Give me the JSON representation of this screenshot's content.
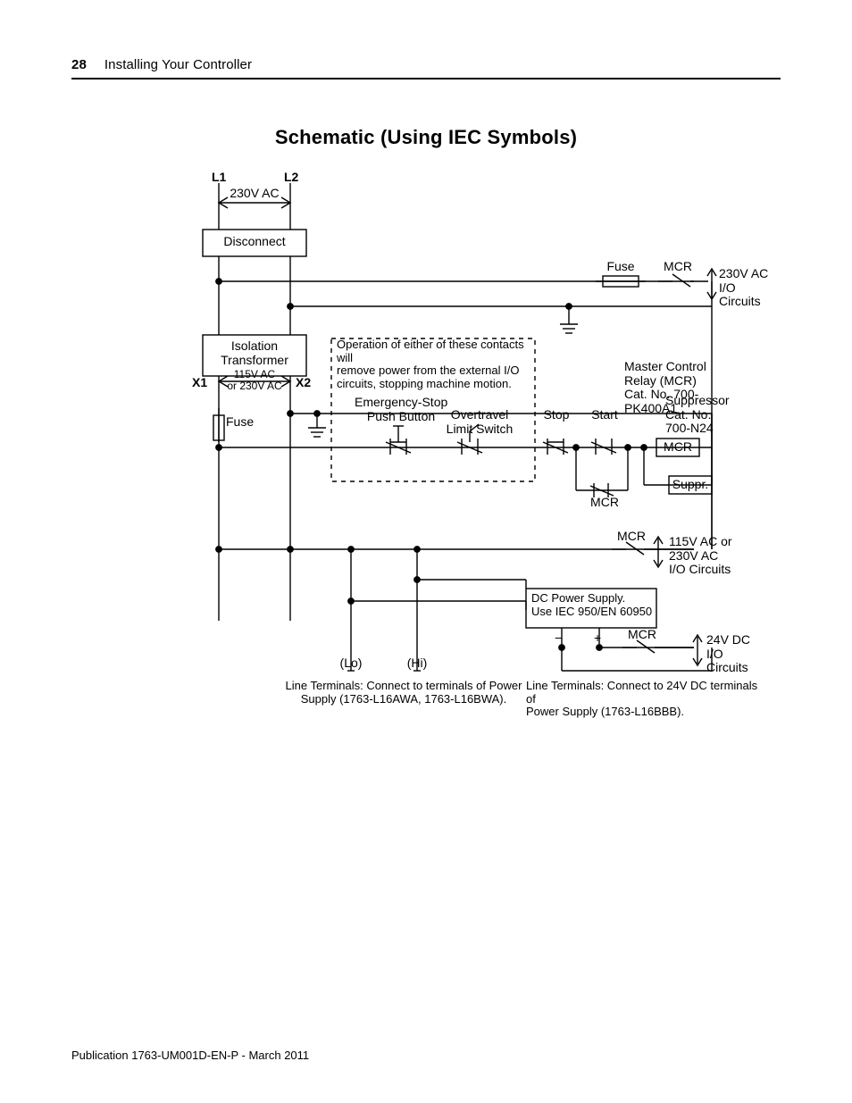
{
  "header": {
    "page_number": "28",
    "section": "Installing Your Controller"
  },
  "title": "Schematic (Using IEC Symbols)",
  "labels": {
    "l1": "L1",
    "l2": "L2",
    "v230": "230V AC",
    "disconnect": "Disconnect",
    "fuse_top": "Fuse",
    "mcr_top": "MCR",
    "right_230": "230V AC\nI/O\nCircuits",
    "iso": "Isolation\nTransformer",
    "x1": "X1",
    "x2": "X2",
    "xvolt": "115V AC\nor 230V AC",
    "fuse_left": "Fuse",
    "op_note": "Operation of either of these contacts will\nremove power from the external I/O\ncircuits, stopping machine motion.",
    "estop": "Emergency-Stop\nPush Button",
    "overtravel": "Overtravel\nLimit Switch",
    "stop": "Stop",
    "start": "Start",
    "mcr_info": "Master Control Relay (MCR)\nCat. No. 700-PK400A1",
    "supp_info": "Suppressor\nCat. No. 700-N24",
    "coil_mcr": "MCR",
    "suppr": "Suppr.",
    "mcr_contact1": "MCR",
    "mcr_contact2": "MCR",
    "mcr_contact3": "MCR",
    "right_115": "115V AC or\n230V AC\nI/O Circuits",
    "dc": "DC Power Supply.\nUse IEC 950/EN 60950",
    "lo": "(Lo)",
    "hi": "(Hi)",
    "minus": "−",
    "plus": "+",
    "lt_text": "Line Terminals: Connect to terminals of Power\nSupply (1763-L16AWA, 1763-L16BWA).",
    "lt2_text": "Line Terminals: Connect to 24V DC terminals of\nPower Supply (1763-L16BBB).",
    "right_24": "24V DC\nI/O\nCircuits"
  },
  "footer": {
    "pub": "Publication 1763-UM001D-EN-P - March 2011"
  }
}
